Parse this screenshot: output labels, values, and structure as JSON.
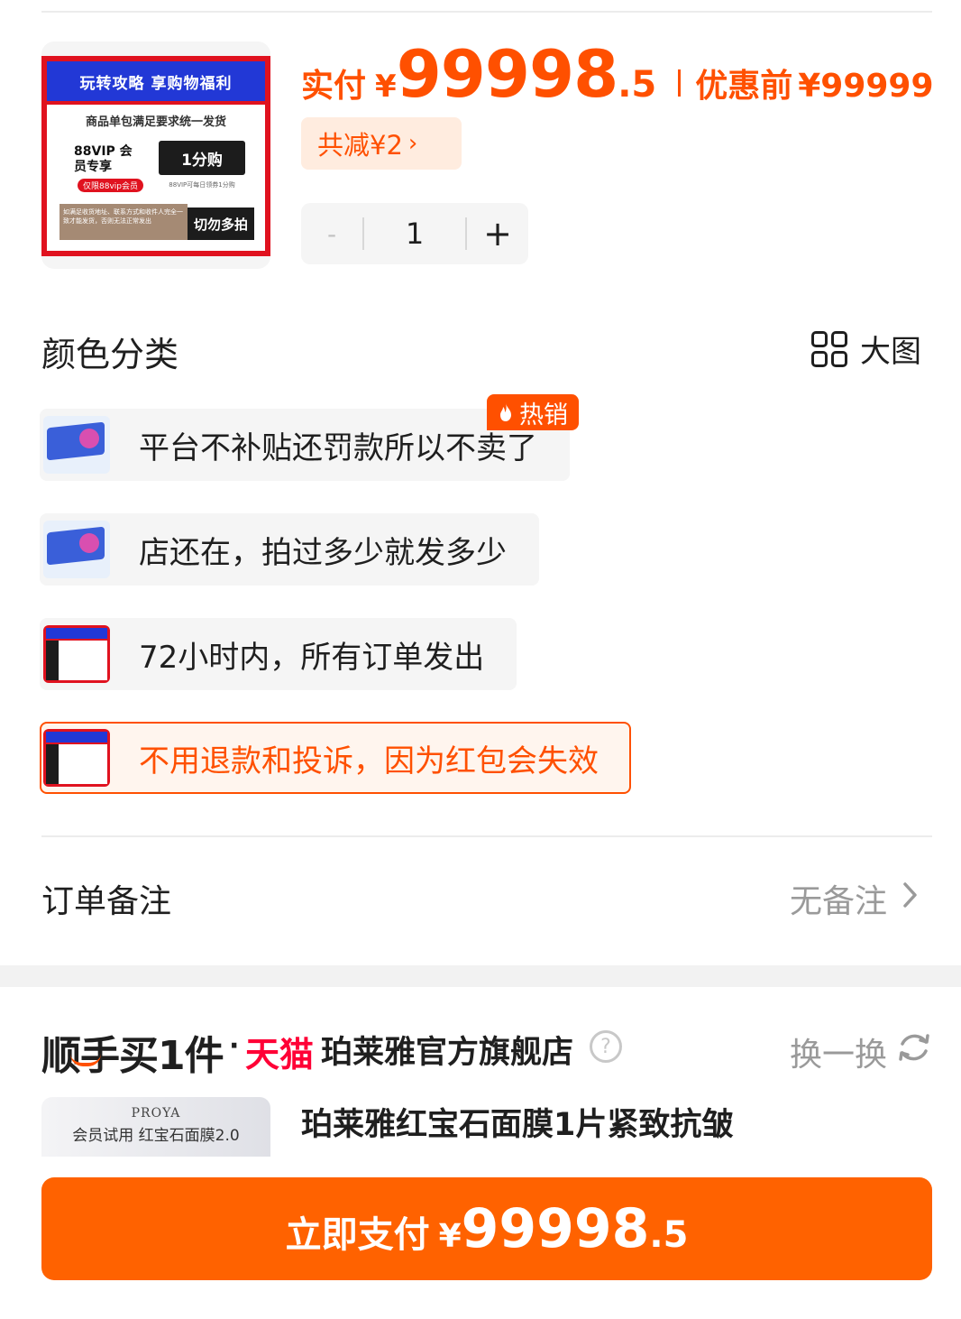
{
  "product": {
    "promo_image": {
      "header": "玩转攻略  享购物福利",
      "line1": "商品单包满足要求统一发货",
      "vip_label": "88VIP 会员专享",
      "vip_pill": "仅限88vip会员",
      "one_cent": "1分购",
      "tiny_note": "88VIP可每日领券1分购",
      "warning": "如满足收货地址、联系方式和收件人完全一致才能发货，否则无法正常发出",
      "no_multi": "切勿多拍"
    },
    "pay_label": "实付",
    "currency": "¥",
    "price_int": "99998",
    "price_dec": ".5",
    "orig_label": "优惠前",
    "orig_price": "¥99999",
    "discount": "共减¥2",
    "discount_chevron": "›",
    "quantity": "1",
    "minus": "-",
    "plus": "+"
  },
  "variants": {
    "title": "颜色分类",
    "big_image_label": "大图",
    "hot_label": "热销",
    "options": [
      {
        "label": "平台不补贴还罚款所以不卖了",
        "thumb": "tissue-box",
        "selected": false
      },
      {
        "label": "店还在，拍过多少就发多少",
        "thumb": "tissue-box",
        "selected": false
      },
      {
        "label": "72小时内，所有订单发出",
        "thumb": "promo-card",
        "selected": false
      },
      {
        "label": "不用退款和投诉，因为红包会失效",
        "thumb": "promo-card",
        "selected": true
      }
    ]
  },
  "remark": {
    "label": "订单备注",
    "value": "无备注"
  },
  "addon": {
    "title": "顺手买1件",
    "separator": "·",
    "tmall": "天猫",
    "store": "珀莱雅官方旗舰店",
    "help": "?",
    "swap_label": "换一换",
    "item_brand": "PROYA",
    "item_image_caption": "会员试用 红宝石面膜2.0",
    "item_name": "珀莱雅红宝石面膜1片紧致抗皱"
  },
  "pay_button": {
    "label": "立即支付",
    "currency": "¥",
    "amount_int": "99998",
    "amount_dec": ".5"
  },
  "colors": {
    "accent": "#ff5000",
    "pay_button": "#ff6200",
    "tmall": "#ff0036",
    "muted_text": "#9a9a9a"
  },
  "icons": [
    "flame-icon",
    "grid-icon",
    "chevron-right-icon",
    "help-icon",
    "refresh-icon"
  ]
}
